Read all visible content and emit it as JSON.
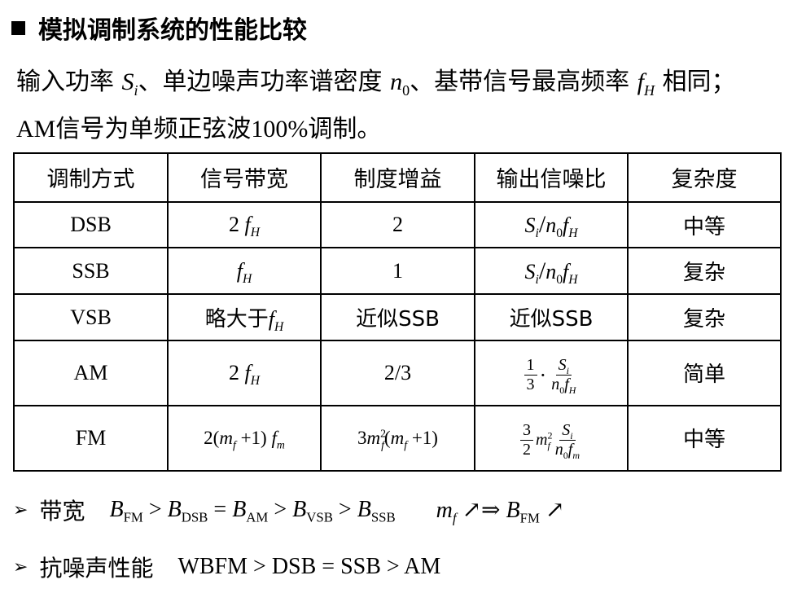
{
  "title": "模拟调制系统的性能比较",
  "intro": {
    "t1": "输入功率 ",
    "Si": "S",
    "Si_sub": "i",
    "t2": "、单边噪声功率谱密度 ",
    "n0": "n",
    "n0_sub": "0",
    "t3": "、基带信号最高频率 ",
    "fH": "f",
    "fH_sub": "H",
    "t4": " 相同；",
    "line2": "AM信号为单频正弦波100%调制。"
  },
  "table": {
    "headers": [
      "调制方式",
      "信号带宽",
      "制度增益",
      "输出信噪比",
      "复杂度"
    ],
    "rows": [
      {
        "name": "DSB",
        "bw_pre": "2",
        "bw_f": "f",
        "bw_sub": "H",
        "gain": "2",
        "snr": "Si/n0fH",
        "complexity": "中等"
      },
      {
        "name": "SSB",
        "bw_pre": "",
        "bw_f": "f",
        "bw_sub": "H",
        "gain": "1",
        "snr": "Si/n0fH",
        "complexity": "复杂"
      },
      {
        "name": "VSB",
        "bw_pre": "略大于",
        "bw_f": "f",
        "bw_sub": "H",
        "gain": "近似SSB",
        "snr_text": "近似SSB",
        "complexity": "复杂"
      },
      {
        "name": "AM",
        "bw_pre": "2",
        "bw_f": "f",
        "bw_sub": "H",
        "gain": "2/3",
        "complexity": "简单"
      },
      {
        "name": "FM",
        "bw_expr": "2(mf + 1) fm",
        "gain_expr": "3mf²(mf + 1)",
        "complexity": "中等"
      }
    ]
  },
  "bullets": {
    "marker": "➢",
    "b1_label": "带宽",
    "b2_label": "抗噪声性能",
    "b2_expr": "WBFM > DSB = SSB > AM"
  }
}
